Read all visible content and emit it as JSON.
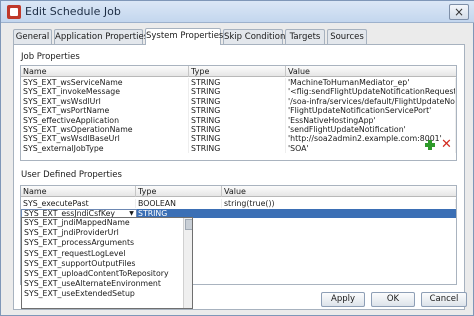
{
  "window": {
    "title": "Edit Schedule Job",
    "close_glyph": "×"
  },
  "tabs": [
    {
      "label": "General"
    },
    {
      "label": "Application Properties"
    },
    {
      "label": "System Properties",
      "active": true
    },
    {
      "label": "Skip Condition"
    },
    {
      "label": "Targets"
    },
    {
      "label": "Sources"
    }
  ],
  "job_properties": {
    "section_label": "Job Properties",
    "columns": [
      "Name",
      "Type",
      "Value"
    ],
    "rows": [
      {
        "name": "SYS_EXT_wsServiceName",
        "type": "STRING",
        "value": "'MachineToHumanMediator_ep'"
      },
      {
        "name": "SYS_EXT_invokeMessage",
        "type": "STRING",
        "value": "'<flig:sendFlightUpdateNotificationRequestM..."
      },
      {
        "name": "SYS_EXT_wsWsdlUrl",
        "type": "STRING",
        "value": "'/soa-infra/services/default/FlightUpdateNoti..."
      },
      {
        "name": "SYS_EXT_wsPortName",
        "type": "STRING",
        "value": "'FlightUpdateNotificationServicePort'"
      },
      {
        "name": "SYS_effectiveApplication",
        "type": "STRING",
        "value": "'EssNativeHostingApp'"
      },
      {
        "name": "SYS_EXT_wsOperationName",
        "type": "STRING",
        "value": "'sendFlightUpdateNotification'"
      },
      {
        "name": "SYS_EXT_wsWsdlBaseUrl",
        "type": "STRING",
        "value": "'http://soa2admin2.example.com:8001'"
      },
      {
        "name": "SYS_externalJobType",
        "type": "STRING",
        "value": "'SOA'"
      }
    ]
  },
  "user_properties": {
    "section_label": "User Defined Properties",
    "add_icon": "add-icon",
    "delete_icon": "delete-icon",
    "columns": [
      "Name",
      "Type",
      "Value"
    ],
    "rows": [
      {
        "name": "SYS_executePast",
        "type": "BOOLEAN",
        "value": "string(true())"
      },
      {
        "name": "SYS_EXT_essJndiCsfKey",
        "type": "STRING",
        "value": "",
        "selected": true
      }
    ],
    "combo": {
      "value": "SYS_EXT_essJndiCsfKey",
      "arrow": "▼"
    },
    "dropdown_options": [
      "SYS_EXT_jndiMappedName",
      "SYS_EXT_jndiProviderUrl",
      "SYS_EXT_processArguments",
      "SYS_EXT_requestLogLevel",
      "SYS_EXT_supportOutputFiles",
      "SYS_EXT_uploadContentToRepository",
      "SYS_EXT_useAlternateEnvironment",
      "SYS_EXT_useExtendedSetup"
    ]
  },
  "buttons": {
    "apply": "Apply",
    "ok": "OK",
    "cancel": "Cancel"
  },
  "colors": {
    "selection": "#3b6fb5",
    "add": "#2e9a2a",
    "delete": "#d22a1f"
  }
}
